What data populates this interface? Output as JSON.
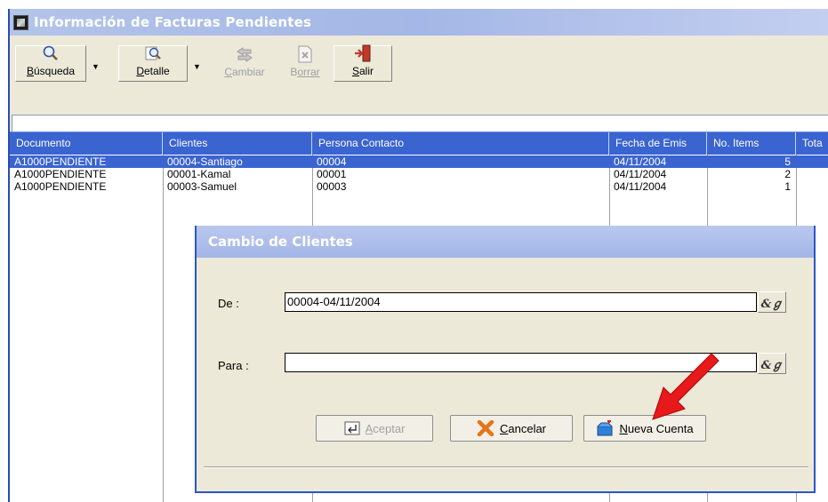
{
  "window": {
    "title": "Información de Facturas Pendientes"
  },
  "toolbar": {
    "buttons": [
      {
        "label_first": "B",
        "label_rest": "úsqueda",
        "icon": "magnifier-icon",
        "enabled": true
      },
      {
        "label_first": "D",
        "label_rest": "etalle",
        "icon": "detail-magnifier-icon",
        "enabled": true
      },
      {
        "label_first": "C",
        "label_rest": "ambiar",
        "icon": "change-arrows-icon",
        "enabled": false
      },
      {
        "label_first": "B",
        "label_rest": "orrar",
        "icon": "delete-document-icon",
        "enabled": false
      },
      {
        "label_first": "S",
        "label_rest": "alir",
        "icon": "exit-door-icon",
        "enabled": true
      }
    ],
    "search_value": ""
  },
  "grid": {
    "columns": [
      "Documento",
      "Clientes",
      "Persona Contacto",
      "Fecha de Emis",
      "No. Items",
      "Tota"
    ],
    "rows": [
      {
        "documento": "A1000PENDIENTE",
        "cliente": "00004-Santiago",
        "contacto": "00004",
        "fecha": "04/11/2004",
        "items": "5",
        "selected": true
      },
      {
        "documento": "A1000PENDIENTE",
        "cliente": "00001-Kamal",
        "contacto": "00001",
        "fecha": "04/11/2004",
        "items": "2",
        "selected": false
      },
      {
        "documento": "A1000PENDIENTE",
        "cliente": "00003-Samuel",
        "contacto": "00003",
        "fecha": "04/11/2004",
        "items": "1",
        "selected": false
      }
    ]
  },
  "dialog": {
    "title": "Cambio de Clientes",
    "de_label": "De :",
    "de_value": "00004-04/11/2004",
    "para_label": "Para :",
    "para_value": "",
    "aceptar_first": "A",
    "aceptar_rest": "ceptar",
    "cancelar_first": "C",
    "cancelar_rest": "ancelar",
    "nueva_first": "N",
    "nueva_rest": "ueva Cuenta"
  },
  "colors": {
    "grid_header": "#3a64d0",
    "selection": "#3a64d0",
    "arrow": "#e8191b",
    "window_face": "#ece9d8"
  }
}
